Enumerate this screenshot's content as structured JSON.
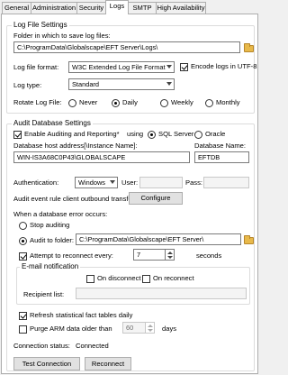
{
  "tabs": [
    "General",
    "Administration",
    "Security",
    "Logs",
    "SMTP",
    "High Availability"
  ],
  "log_settings": {
    "title": "Log File Settings",
    "folder_label": "Folder in which to save log files:",
    "folder_value": "C:\\ProgramData\\Globalscape\\EFT Server\\Logs\\",
    "format_label": "Log file format:",
    "format_value": "W3C Extended Log File Format",
    "encode_label": "Encode logs in UTF-8",
    "type_label": "Log type:",
    "type_value": "Standard",
    "rotate_label": "Rotate Log File:",
    "rotate_options": [
      "Never",
      "Daily",
      "Weekly",
      "Monthly"
    ]
  },
  "audit": {
    "title": "Audit Database Settings",
    "enable_label": "Enable Auditing and Reporting*",
    "using_label": "using",
    "sql_label": "SQL Server",
    "oracle_label": "Oracle",
    "host_label": "Database host address[\\Instance Name]:",
    "host_value": "WIN-IS3A68C0P43\\GLOBALSCAPE",
    "dbname_label": "Database Name:",
    "dbname_value": "EFTDB",
    "auth_label": "Authentication:",
    "auth_value": "Windows",
    "user_label": "User:",
    "pass_label": "Pass:",
    "outbound_label": "Audit event rule client outbound transfer:",
    "configure_label": "Configure",
    "error_label": "When a database error occurs:",
    "stop_label": "Stop auditing",
    "audit_folder_label": "Audit to folder:",
    "audit_folder_value": "C:\\ProgramData\\Globalscape\\EFT Server\\",
    "reconnect_label": "Attempt to reconnect every:",
    "reconnect_value": "7",
    "seconds_label": "seconds",
    "email_title": "E-mail notification",
    "on_disconnect_label": "On disconnect",
    "on_reconnect_label": "On reconnect",
    "recipient_label": "Recipient list:",
    "refresh_label": "Refresh statistical fact tables daily",
    "purge_label": "Purge ARM data older than",
    "purge_value": "60",
    "days_label": "days",
    "status_label": "Connection status:",
    "status_value": "Connected",
    "test_label": "Test Connection",
    "reconnect_btn_label": "Reconnect"
  }
}
